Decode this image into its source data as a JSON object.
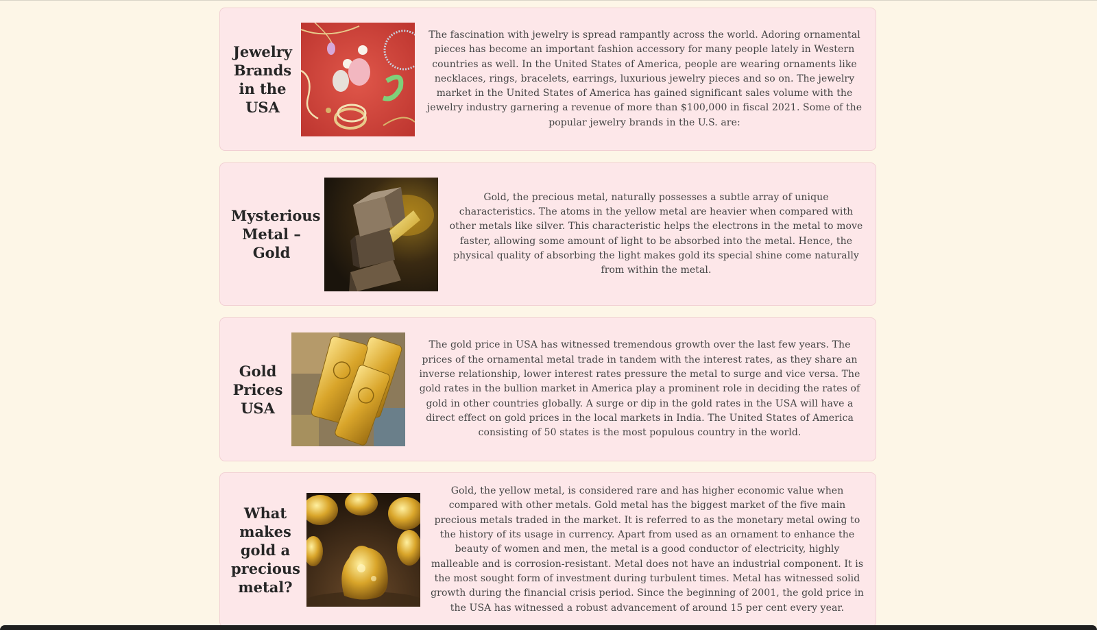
{
  "articles": [
    {
      "heading": "Jewelry Brands in the USA",
      "image": "jewelry-earrings-rings-necklaces-image",
      "body": "The fascination with jewelry is spread rampantly across the world. Adoring ornamental pieces has become an important fashion accessory for many people lately in Western countries as well. In the United States of America, people are wearing ornaments like necklaces, rings, bracelets, earrings, luxurious jewelry pieces and so on. The jewelry market in the United States of America has gained significant sales volume with the jewelry industry garnering a revenue of more than $100,000 in fiscal 2021. Some of the popular jewelry brands in the U.S. are:"
    },
    {
      "heading": "Mysterious Metal – Gold",
      "image": "glowing-metal-cubes-image",
      "body": "Gold, the precious metal, naturally possesses a subtle array of unique characteristics. The atoms in the yellow metal are heavier when compared with other metals like silver. This characteristic helps the electrons in the metal to move faster, allowing some amount of light to be absorbed into the metal. Hence, the physical quality of absorbing the light makes gold its special shine come naturally from within the metal."
    },
    {
      "heading": "Gold Prices USA",
      "image": "gold-bullion-bars-image",
      "body": "The gold price in USA has witnessed tremendous growth over the last few years. The prices of the ornamental metal trade in tandem with the interest rates, as they share an inverse relationship, lower interest rates pressure the metal to surge and vice versa. The gold rates in the bullion market in America play a prominent role in deciding the rates of gold in other countries globally. A surge or dip in the gold rates in the USA will have a direct effect on gold prices in the local markets in India. The United States of America consisting of 50 states is the most populous country in the world."
    },
    {
      "heading": "What makes gold a precious metal?",
      "image": "gold-nuggets-image",
      "body": "Gold, the yellow metal, is considered rare and has higher economic value when compared with other metals. Gold metal has the biggest market of the five main precious metals traded in the market. It is referred to as the monetary metal owing to the history of its usage in currency. Apart from used as an ornament to enhance the beauty of women and men, the metal is a good conductor of electricity, highly malleable and is corrosion-resistant. Metal does not have an industrial component. It is the most sought form of investment during turbulent times. Metal has witnessed solid growth during the financial crisis period. Since the beginning of 2001, the gold price in the USA has witnessed a robust advancement of around 15 per cent every year."
    }
  ],
  "colors": {
    "page_background": "#fdf6e7",
    "card_background": "#fde7e9",
    "card_border": "#f1cfd3",
    "heading_text": "#262626",
    "body_text": "#444444"
  }
}
